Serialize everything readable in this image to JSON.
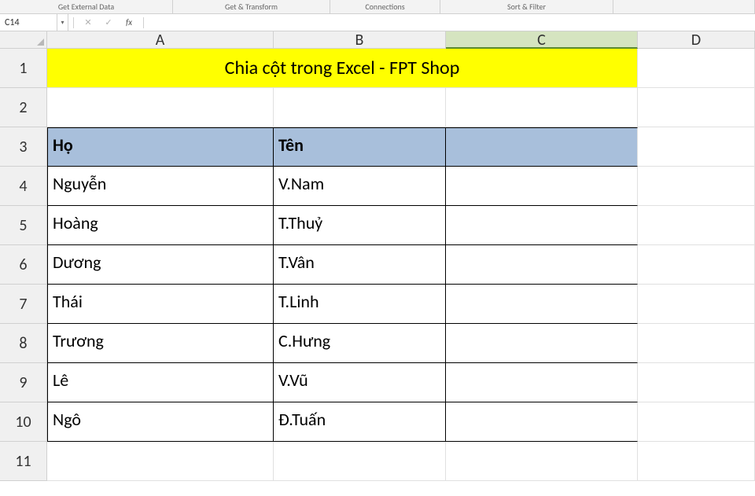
{
  "ribbon": {
    "groups": [
      "Get External Data",
      "Get & Transform",
      "Connections",
      "Sort & Filter"
    ]
  },
  "formula_bar": {
    "name_box": "C14",
    "cancel": "✕",
    "enter": "✓",
    "fx": "fx",
    "value": ""
  },
  "columns": [
    "A",
    "B",
    "C",
    "D"
  ],
  "rows_labels": [
    "1",
    "2",
    "3",
    "4",
    "5",
    "6",
    "7",
    "8",
    "9",
    "10",
    "11"
  ],
  "title": "Chia cột trong Excel - FPT Shop",
  "headers": {
    "a": "Họ",
    "b": "Tên",
    "c": ""
  },
  "data_rows": [
    {
      "a": "Nguyễn",
      "b": "V.Nam",
      "c": ""
    },
    {
      "a": "Hoàng",
      "b": "T.Thuỷ",
      "c": ""
    },
    {
      "a": "Dương",
      "b": "T.Vân",
      "c": ""
    },
    {
      "a": "Thái",
      "b": "T.Linh",
      "c": ""
    },
    {
      "a": "Trương",
      "b": "C.Hưng",
      "c": ""
    },
    {
      "a": "Lê",
      "b": "V.Vũ",
      "c": ""
    },
    {
      "a": "Ngô",
      "b": "Đ.Tuấn",
      "c": ""
    }
  ]
}
